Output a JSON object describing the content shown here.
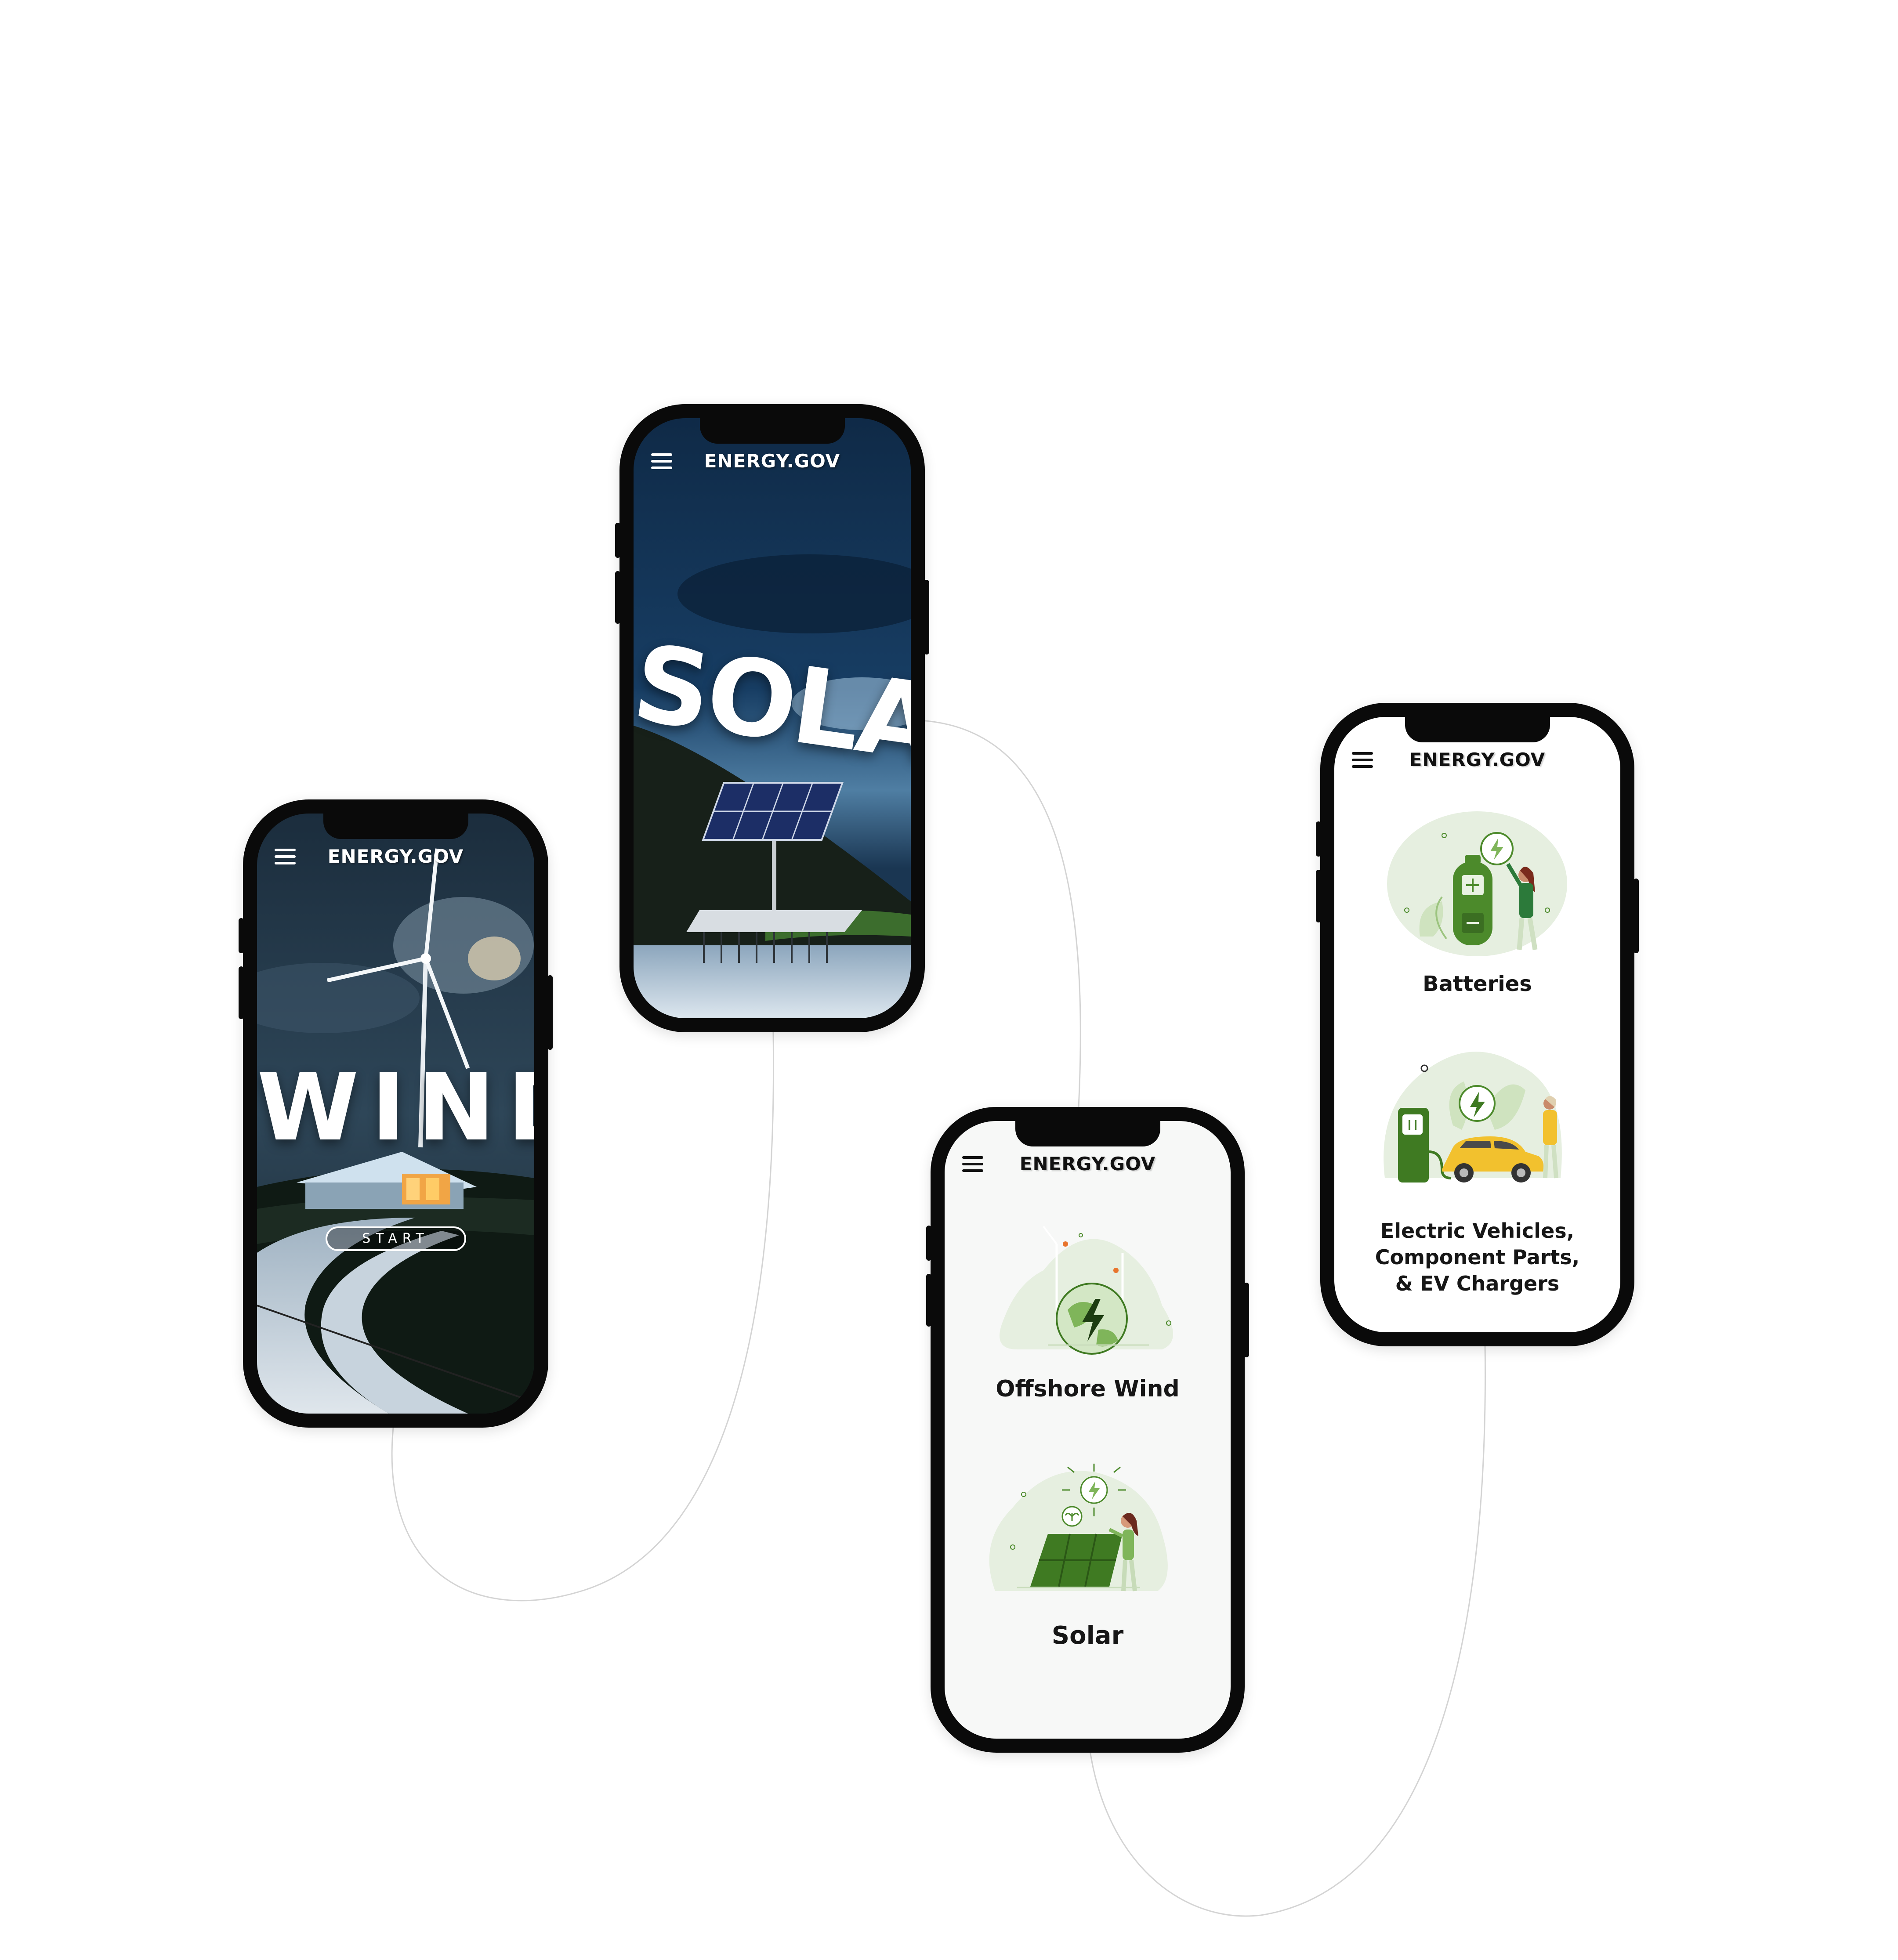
{
  "brand": "ENERGY.GOV",
  "screens": {
    "wind": {
      "hero_word": "WIND",
      "start_label": "START"
    },
    "solar": {
      "hero_word": "SOLAR"
    },
    "categories_a": {
      "items": [
        {
          "label": "Offshore Wind",
          "icon": "globe-lightning-icon"
        },
        {
          "label": "Solar",
          "icon": "solar-panel-icon"
        }
      ]
    },
    "categories_b": {
      "items": [
        {
          "label": "Batteries",
          "icon": "battery-icon"
        },
        {
          "label_lines": [
            "Electric Vehicles,",
            "Component Parts,",
            "& EV Chargers"
          ],
          "icon": "ev-charger-icon"
        }
      ]
    }
  },
  "colors": {
    "accent_green": "#4c8a2b",
    "light_green": "#e8f1e1",
    "ev_yellow": "#f2c12e"
  }
}
